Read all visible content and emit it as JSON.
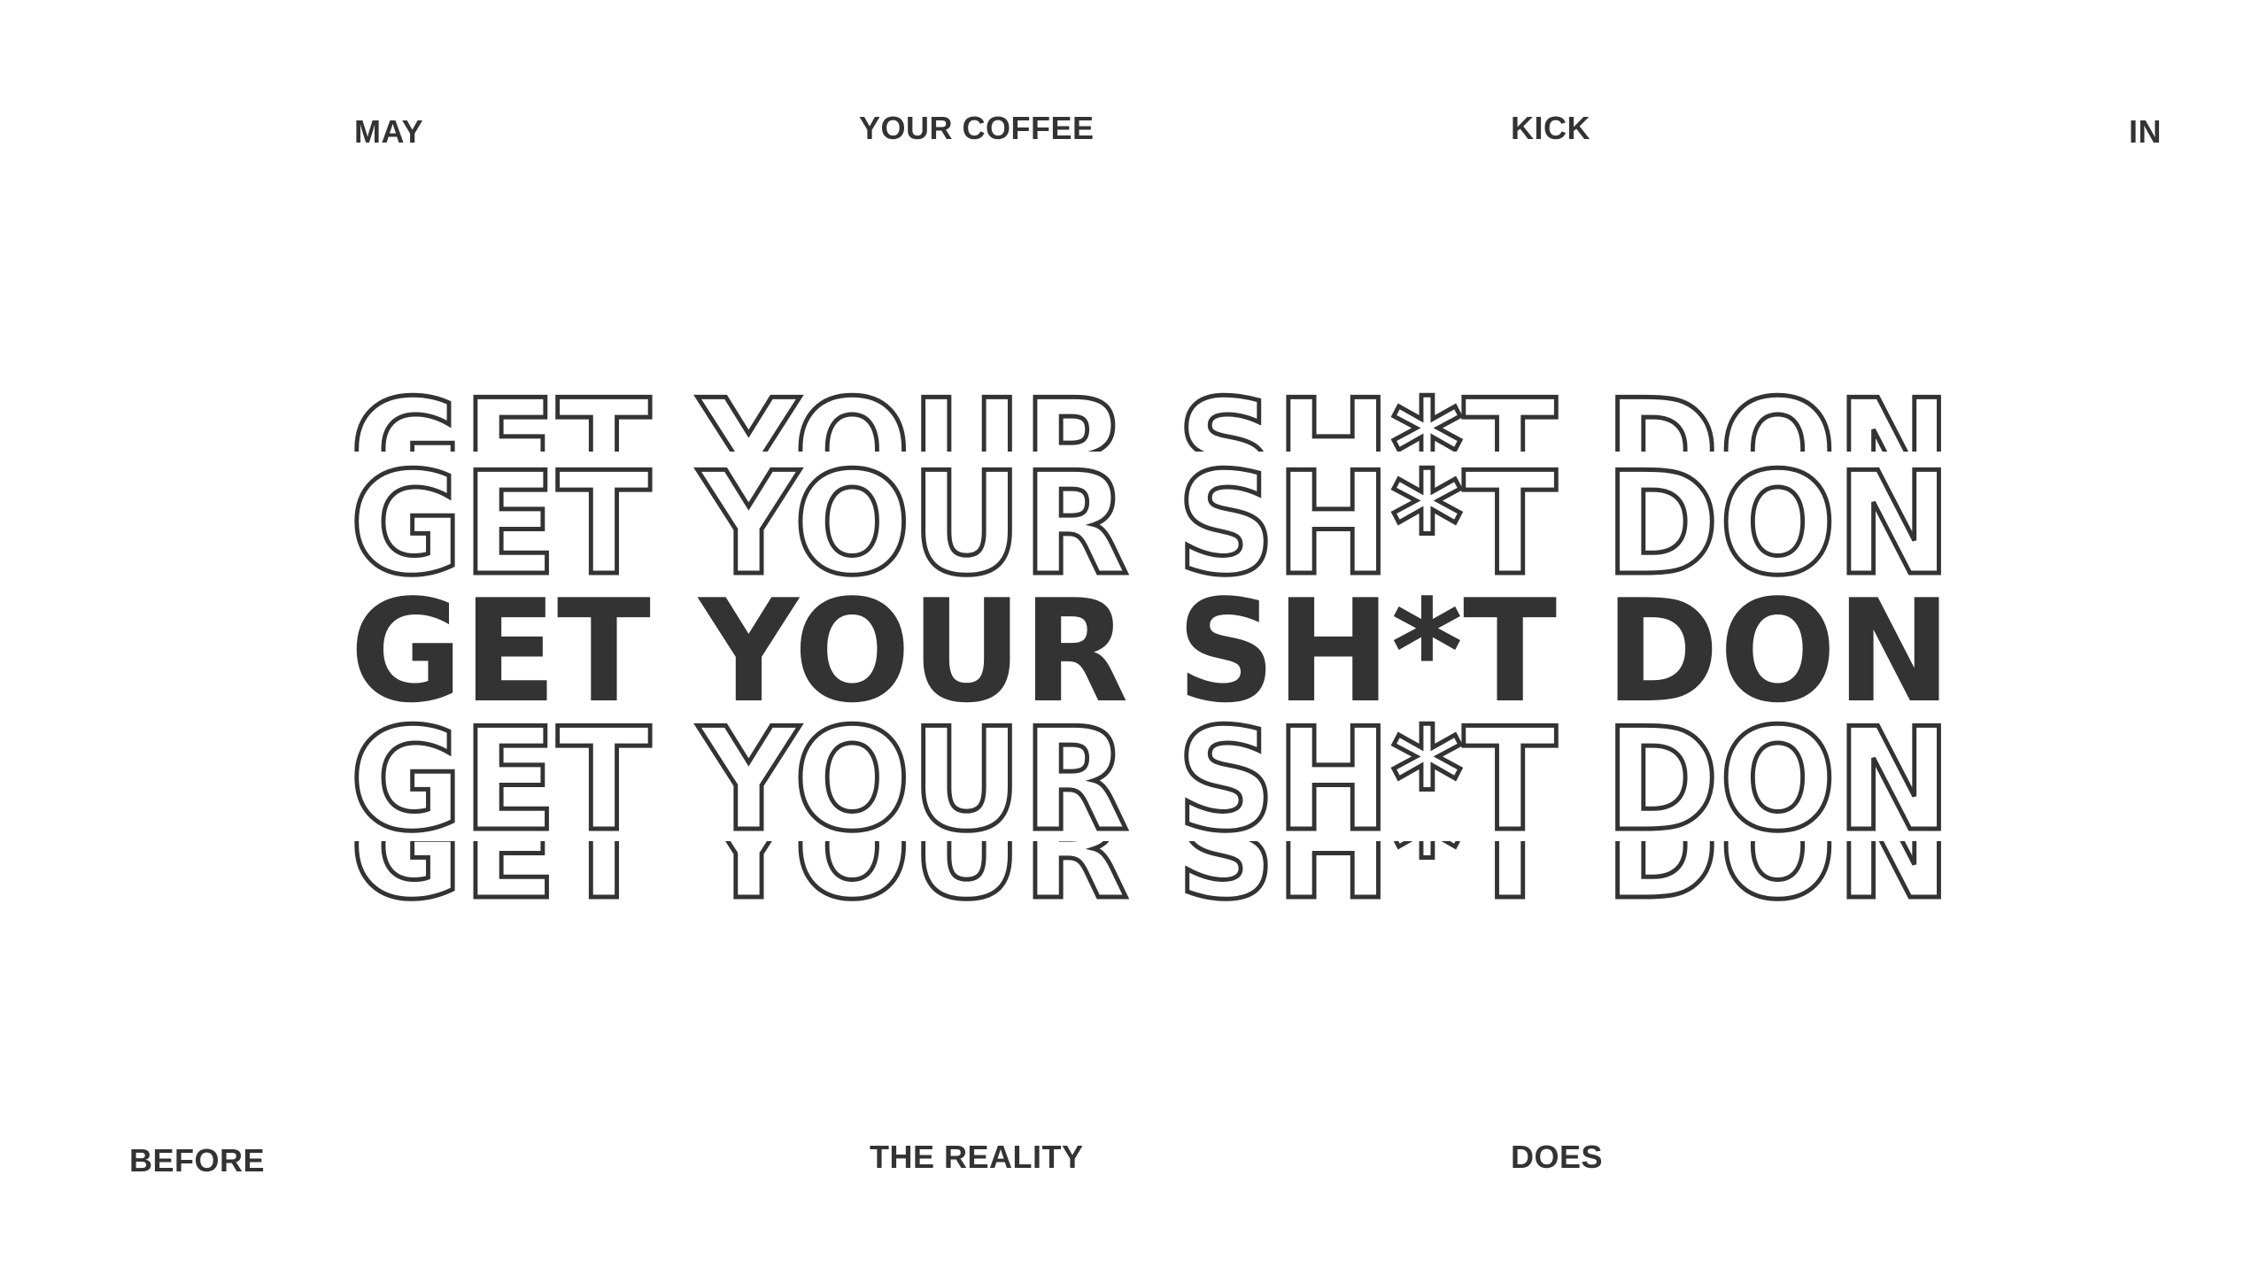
{
  "top_words": [
    "MAY",
    "YOUR COFFEE",
    "KICK",
    "IN"
  ],
  "bottom_words": [
    "BEFORE",
    "THE REALITY",
    "DOES"
  ],
  "headline": "GET YOUR SH*T DONE",
  "colors": {
    "text": "#333333",
    "background": "#ffffff"
  }
}
